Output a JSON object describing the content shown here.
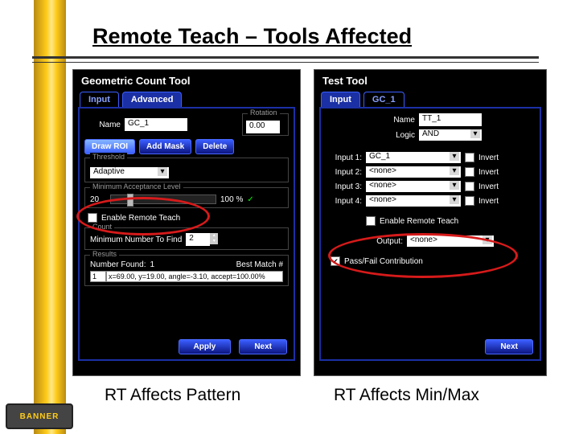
{
  "title": "Remote Teach – Tools Affected",
  "left_panel": {
    "title": "Geometric Count Tool",
    "tabs": [
      "Input",
      "Advanced"
    ],
    "active_tab": 1,
    "name_label": "Name",
    "name_value": "GC_1",
    "buttons": {
      "draw": "Draw ROI",
      "mask": "Add Mask",
      "delete": "Delete"
    },
    "rotation": {
      "legend": "Rotation",
      "value": "0.00"
    },
    "threshold": {
      "legend": "Threshold",
      "value": "Adaptive"
    },
    "min_accept": {
      "legend": "Minimum Acceptance Level",
      "value": "20",
      "pct": "100 %",
      "check": "✓"
    },
    "enable_rt": "Enable Remote Teach",
    "count": {
      "legend": "Count",
      "label": "Minimum Number To Find",
      "value": "2"
    },
    "results": {
      "legend": "Results",
      "found_label": "Number Found:",
      "found_value": "1",
      "best_label": "Best Match #",
      "row_num": "1",
      "row_text": "x=69.00, y=19.00, angle=-3.10, accept=100.00%"
    },
    "apply": "Apply",
    "next": "Next"
  },
  "right_panel": {
    "title": "Test Tool",
    "tabs": [
      "Input",
      "GC_1"
    ],
    "active_tab": 0,
    "name_label": "Name",
    "name_value": "TT_1",
    "logic_label": "Logic",
    "logic_value": "AND",
    "inputs": [
      {
        "label": "Input 1:",
        "value": "GC_1",
        "invert": "Invert"
      },
      {
        "label": "Input 2:",
        "value": "<none>",
        "invert": "Invert"
      },
      {
        "label": "Input 3:",
        "value": "<none>",
        "invert": "Invert"
      },
      {
        "label": "Input 4:",
        "value": "<none>",
        "invert": "Invert"
      }
    ],
    "enable_rt": "Enable Remote Teach",
    "output_label": "Output:",
    "output_value": "<none>",
    "passfail": "Pass/Fail Contribution",
    "next": "Next"
  },
  "captions": {
    "left": "RT Affects Pattern",
    "right": "RT Affects Min/Max"
  },
  "logo": "BANNER"
}
